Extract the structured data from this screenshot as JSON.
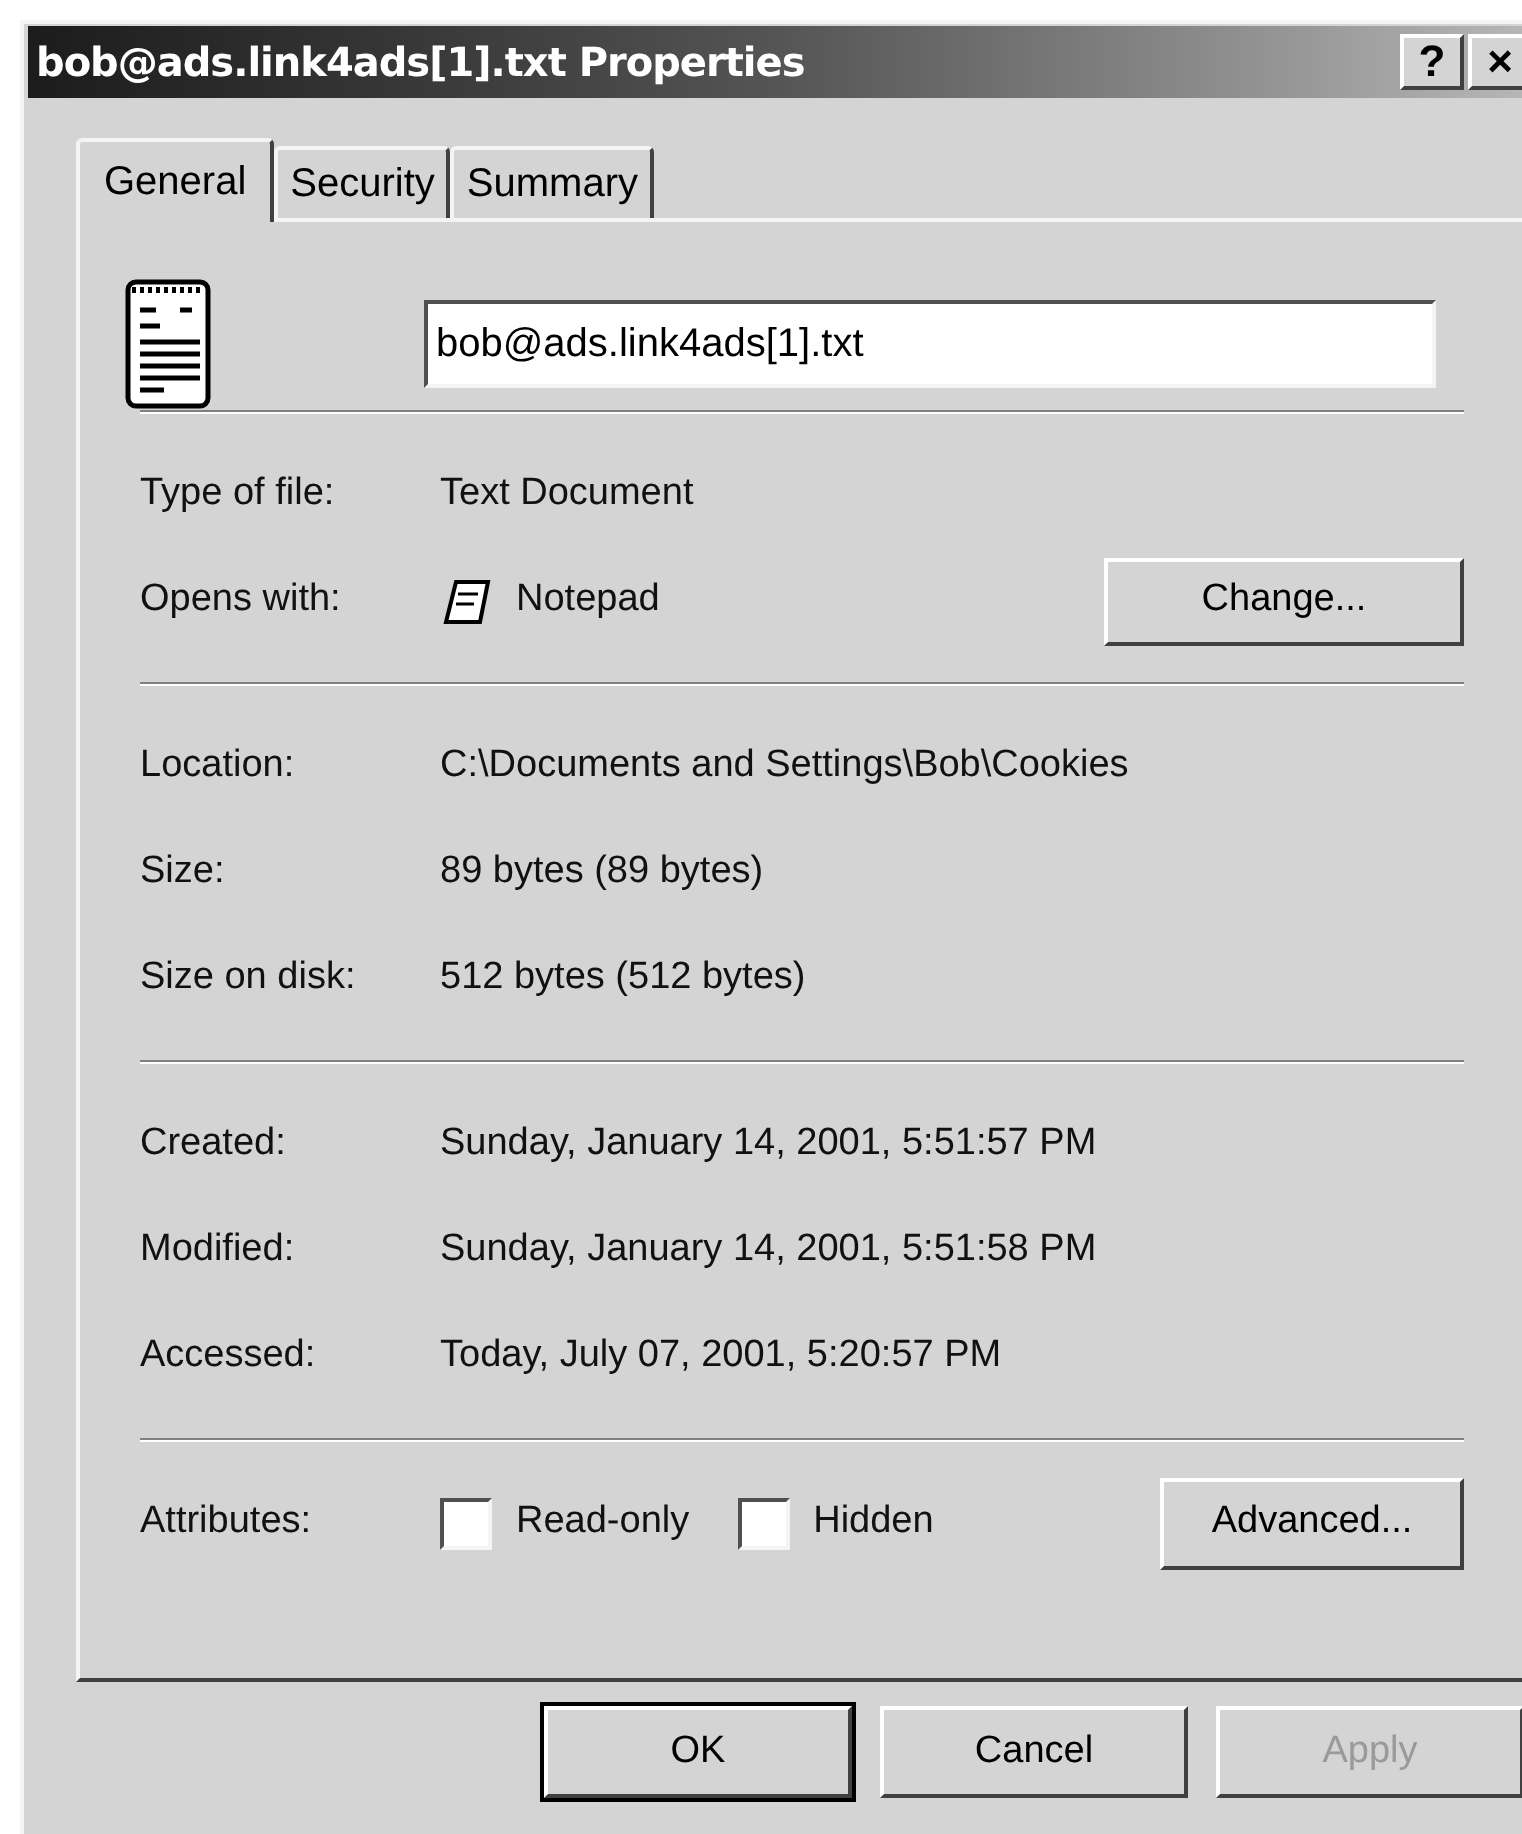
{
  "window": {
    "title": "bob@ads.link4ads[1].txt Properties",
    "title_buttons": [
      "?",
      "×"
    ]
  },
  "tabs": [
    {
      "label": "General",
      "selected": true
    },
    {
      "label": "Security",
      "selected": false
    },
    {
      "label": "Summary",
      "selected": false
    }
  ],
  "file_name": {
    "value": "bob@ads.link4ads[1].txt"
  },
  "sections": [
    [
      {
        "label": "Type of file:",
        "value": "Text Document"
      },
      {
        "label": "Opens with:",
        "value": "Notepad",
        "kind": "app",
        "button": "Change..."
      }
    ],
    [
      {
        "label": "Location:",
        "value": "C:\\Documents and Settings\\Bob\\Cookies"
      },
      {
        "label": "Size:",
        "value": "89 bytes (89 bytes)"
      },
      {
        "label": "Size on disk:",
        "value": "512 bytes (512 bytes)"
      }
    ],
    [
      {
        "label": "Created:",
        "value": "Sunday, January 14, 2001, 5:51:57 PM"
      },
      {
        "label": "Modified:",
        "value": "Sunday, January 14, 2001, 5:51:58 PM"
      },
      {
        "label": "Accessed:",
        "value": "Today, July 07, 2001, 5:20:57 PM"
      }
    ]
  ],
  "attributes": {
    "label": "Attributes:",
    "checkboxes": [
      {
        "label": "Read-only",
        "checked": false
      },
      {
        "label": "Hidden",
        "checked": false
      }
    ],
    "button": "Advanced..."
  },
  "buttons": [
    {
      "label": "OK",
      "disabled": false,
      "default": true
    },
    {
      "label": "Cancel",
      "disabled": false,
      "default": false
    },
    {
      "label": "Apply",
      "disabled": true,
      "default": false
    }
  ]
}
